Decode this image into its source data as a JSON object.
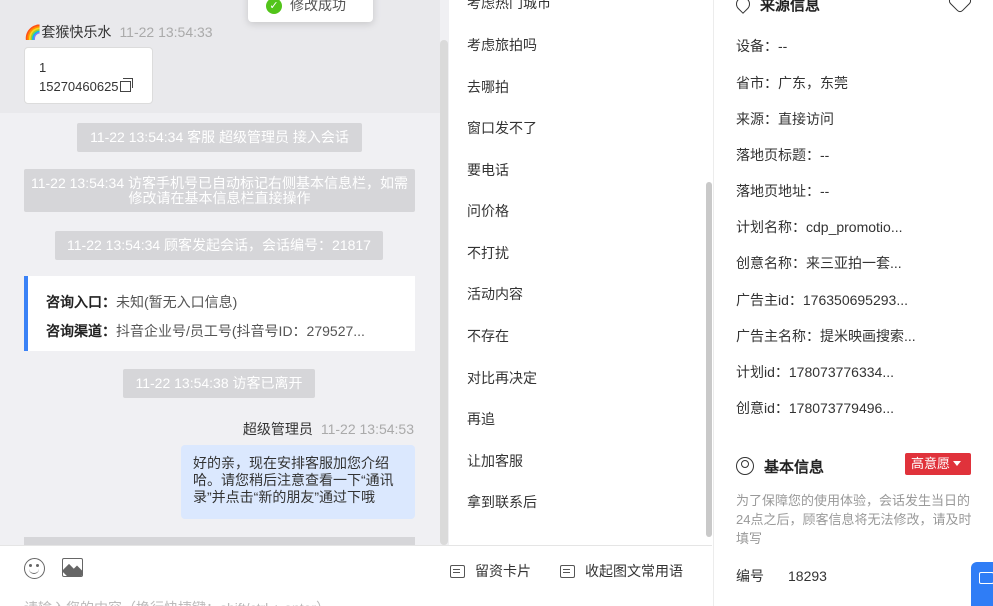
{
  "toast": {
    "text": "修改成功"
  },
  "chat": {
    "visitor_name": "🌈套猴快乐水",
    "visitor_time": "11-22 13:54:33",
    "phone_card": {
      "line1": "1",
      "line2": "15270460625"
    },
    "system_notes": [
      "11-22 13:54:34 客服 超级管理员 接入会话",
      "11-22 13:54:34 访客手机号已自动标记右侧基本信息栏，如需修改请在基本信息栏直接操作",
      "11-22 13:54:34 顾客发起会话，会话编号：21817",
      "11-22 13:54:38 访客已离开"
    ],
    "consult": {
      "entry_label": "咨询入口：",
      "entry_value": "未知(暂无入口信息)",
      "channel_label": "咨询渠道：",
      "channel_value": "抖音企业号/员工号(抖音号ID：279527..."
    },
    "agent_name": "超级管理员",
    "agent_time": "11-22 13:54:53",
    "agent_message": "好的亲，现在安排客服加您介绍哈。请您稍后注意查看一下“通讯录”并点击“新的朋友”通过下哦",
    "input_placeholder": "请输入您的内容（换行快捷键：shift/ctrl + enter）",
    "tools": {
      "card_label": "留资卡片",
      "phrases_label": "收起图文常用语"
    }
  },
  "phrases": [
    "考虑热门城市",
    "考虑旅拍吗",
    "去哪拍",
    "窗口发不了",
    "要电话",
    "问价格",
    "不打扰",
    "活动内容",
    "不存在",
    "对比再决定",
    "再追",
    "让加客服",
    "拿到联系后"
  ],
  "source_info": {
    "title": "来源信息",
    "fields": [
      "设备：--",
      "省市：广东，东莞",
      "来源：直接访问",
      "落地页标题：--",
      "落地页地址：--",
      "计划名称：cdp_promotio...",
      "创意名称：来三亚拍一套...",
      "广告主id：176350695293...",
      "广告主名称：提米映画搜索...",
      "计划id：178073776334...",
      "创意id：178073779496..."
    ]
  },
  "basic_info": {
    "title": "基本信息",
    "intent_badge": "高意愿",
    "notice": "为了保障您的使用体验，会话发生当日的24点之后，顾客信息将无法修改，请及时填写",
    "code_label": "编号",
    "code_value": "18293"
  },
  "colors": {
    "accent": "#3b82f6",
    "badge_red": "#e0323b",
    "bubble_blue": "#dbe8fe",
    "success_green": "#52c41a"
  }
}
